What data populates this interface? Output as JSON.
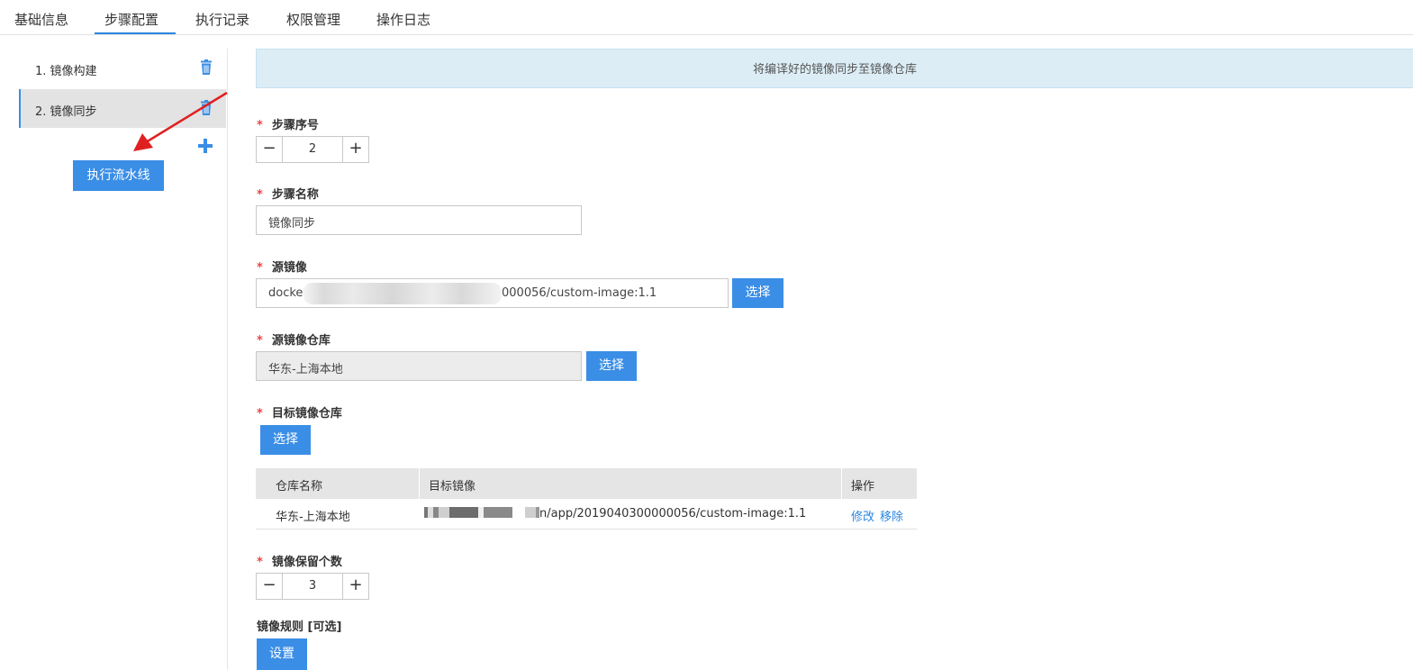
{
  "tabs": [
    {
      "label": "基础信息"
    },
    {
      "label": "步骤配置",
      "active": true
    },
    {
      "label": "执行记录"
    },
    {
      "label": "权限管理"
    },
    {
      "label": "操作日志"
    }
  ],
  "steps": [
    {
      "label": "1. 镜像构建"
    },
    {
      "label": "2. 镜像同步",
      "active": true
    }
  ],
  "run_pipeline_label": "执行流水线",
  "info_banner": "将编译好的镜像同步至镜像仓库",
  "form": {
    "required_mark": "*",
    "step_order": {
      "label": "步骤序号",
      "value": "2"
    },
    "step_name": {
      "label": "步骤名称",
      "value": "镜像同步"
    },
    "source_image": {
      "label": "源镜像",
      "value_prefix": "docke",
      "value_suffix": "000056/custom-image:1.1",
      "select_label": "选择"
    },
    "source_repo": {
      "label": "源镜像仓库",
      "value": "华东-上海本地",
      "select_label": "选择"
    },
    "target_repo": {
      "label": "目标镜像仓库",
      "select_label": "选择"
    },
    "retain_count": {
      "label": "镜像保留个数",
      "value": "3"
    },
    "image_rules": {
      "label": "镜像规则 [可选]",
      "set_label": "设置"
    }
  },
  "target_table": {
    "headers": [
      "仓库名称",
      "目标镜像",
      "操作"
    ],
    "rows": [
      {
        "repo": "华东-上海本地",
        "image_suffix": "n/app/2019040300000056/custom-image:1.1",
        "edit": "修改",
        "remove": "移除"
      }
    ]
  },
  "stepper": {
    "minus": "−",
    "plus": "+"
  },
  "colors": {
    "primary": "#3a8ee6",
    "required": "#e44444",
    "banner_bg": "#dcedf6",
    "annotation_arrow": "#e02020"
  }
}
